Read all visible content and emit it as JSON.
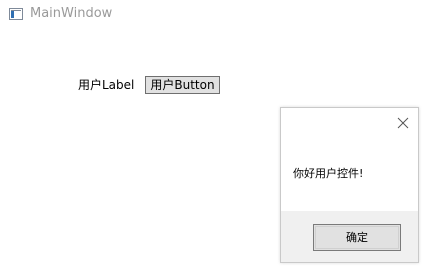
{
  "window": {
    "title": "MainWindow",
    "icon": "app-window-icon"
  },
  "main": {
    "label_text": "用户Label",
    "button_label": "用户Button"
  },
  "dialog": {
    "message": "你好用户控件!",
    "ok_label": "确定",
    "close_icon": "close-icon"
  },
  "colors": {
    "title_text": "#9a9a9a",
    "button_face": "#e1e1e1",
    "dialog_footer": "#f0f0f0"
  }
}
